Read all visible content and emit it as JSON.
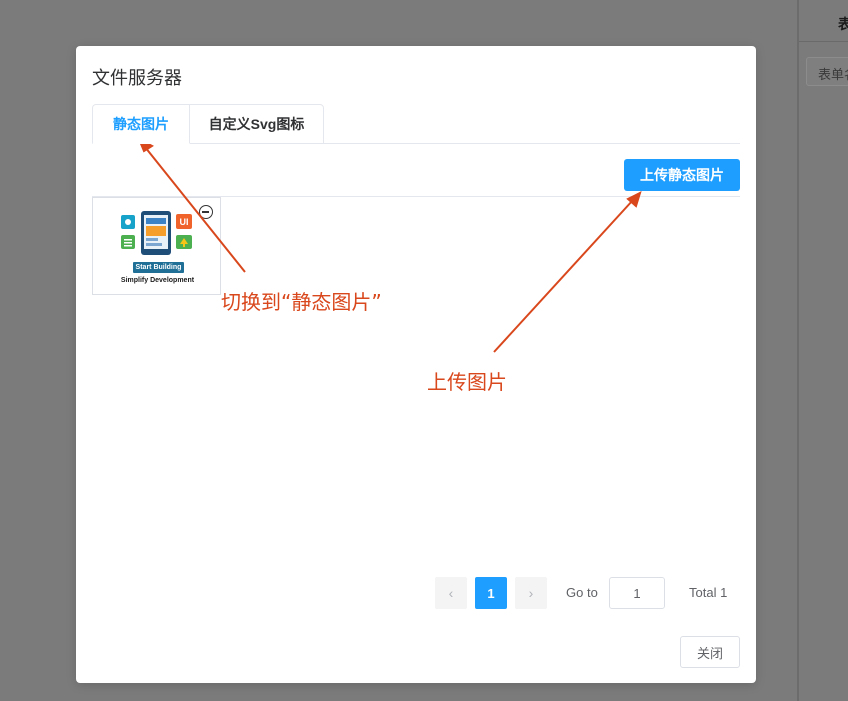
{
  "background": {
    "tab_label": "表",
    "input_placeholder": "表单名称"
  },
  "dialog": {
    "title": "文件服务器",
    "tabs": [
      {
        "label": "静态图片",
        "active": true
      },
      {
        "label": "自定义Svg图标",
        "active": false
      }
    ],
    "upload_button": "上传静态图片",
    "images": [
      {
        "button_text": "Start Building",
        "caption": "Simplify Development",
        "ui_badge": "UI"
      }
    ],
    "pagination": {
      "prev_icon": "chevron-left-icon",
      "next_icon": "chevron-right-icon",
      "current_page": "1",
      "goto_label": "Go to",
      "goto_value": "1",
      "total": "Total 1"
    },
    "close_button": "关闭"
  },
  "annotations": {
    "switch_tab": "切换到“静态图片”",
    "upload": "上传图片"
  },
  "colors": {
    "accent": "#1e9fff",
    "annotation": "#d9471c",
    "overlay": "#7b7b7b"
  }
}
